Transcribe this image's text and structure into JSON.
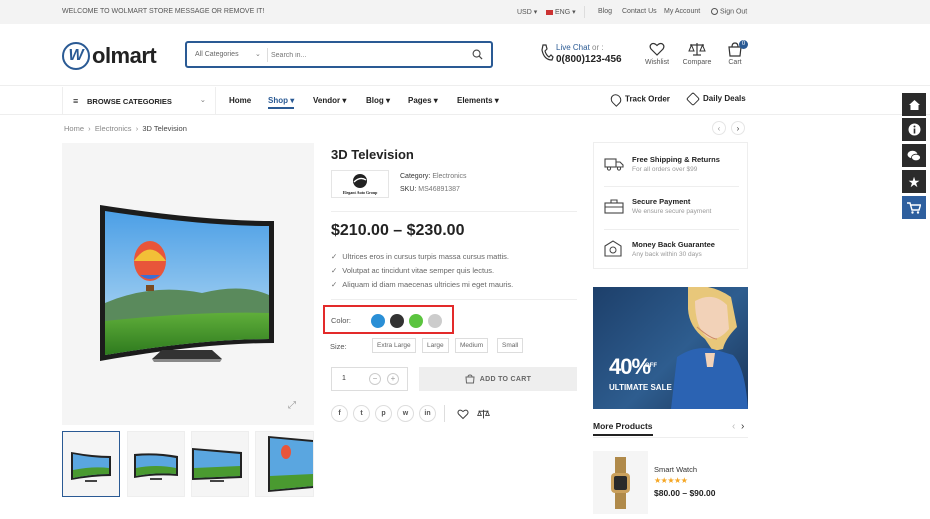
{
  "topbar": {
    "message": "WELCOME TO WOLMART STORE MESSAGE OR REMOVE IT!",
    "currency": "USD",
    "language": "ENG",
    "links": [
      "Blog",
      "Contact Us",
      "My Account",
      "Sign Out"
    ]
  },
  "header": {
    "logo_mark": "W",
    "logo_text": "olmart",
    "search_category": "All Categories",
    "search_placeholder": "Search in...",
    "live_chat": "Live Chat",
    "live_chat_or": "or :",
    "phone": "0(800)123-456",
    "wishlist": "Wishlist",
    "compare": "Compare",
    "cart": "Cart",
    "cart_count": "0"
  },
  "nav": {
    "browse": "BROWSE CATEGORIES",
    "items": [
      "Home",
      "Shop",
      "Vendor",
      "Blog",
      "Pages",
      "Elements"
    ],
    "track_order": "Track Order",
    "daily_deals": "Daily Deals"
  },
  "breadcrumb": [
    "Home",
    "Electronics",
    "3D Television"
  ],
  "product": {
    "title": "3D Television",
    "brand_name": "Elegant Auto Group",
    "category_label": "Category:",
    "category": "Electronics",
    "sku_label": "SKU:",
    "sku": "MS46891387",
    "price": "$210.00 – $230.00",
    "features": [
      "Ultrices eros in cursus turpis massa cursus mattis.",
      "Volutpat ac tincidunt vitae semper quis lectus.",
      "Aliquam id diam maecenas ultricies mi eget mauris."
    ],
    "color_label": "Color:",
    "colors": [
      "#2a8fd6",
      "#333333",
      "#5bc43f",
      "#cccccc"
    ],
    "size_label": "Size:",
    "sizes": [
      "Extra Large",
      "Large",
      "Medium",
      "Small"
    ],
    "quantity": "1",
    "add_to_cart": "ADD TO CART",
    "social_icons": [
      "f",
      "t",
      "p",
      "w",
      "in"
    ]
  },
  "services": [
    {
      "title": "Free Shipping & Returns",
      "sub": "For all orders over $99"
    },
    {
      "title": "Secure Payment",
      "sub": "We ensure secure payment"
    },
    {
      "title": "Money Back Guarantee",
      "sub": "Any back within 30 days"
    }
  ],
  "banner": {
    "big": "40%",
    "off": "OFF",
    "text": "ULTIMATE SALE"
  },
  "more_products": {
    "title": "More Products",
    "item_name": "Smart Watch",
    "rating_stars": 5,
    "item_price": "$80.00 – $90.00"
  },
  "side_toolbar": [
    "home-icon",
    "info-icon",
    "chat-icon",
    "star-icon",
    "cart-icon"
  ]
}
